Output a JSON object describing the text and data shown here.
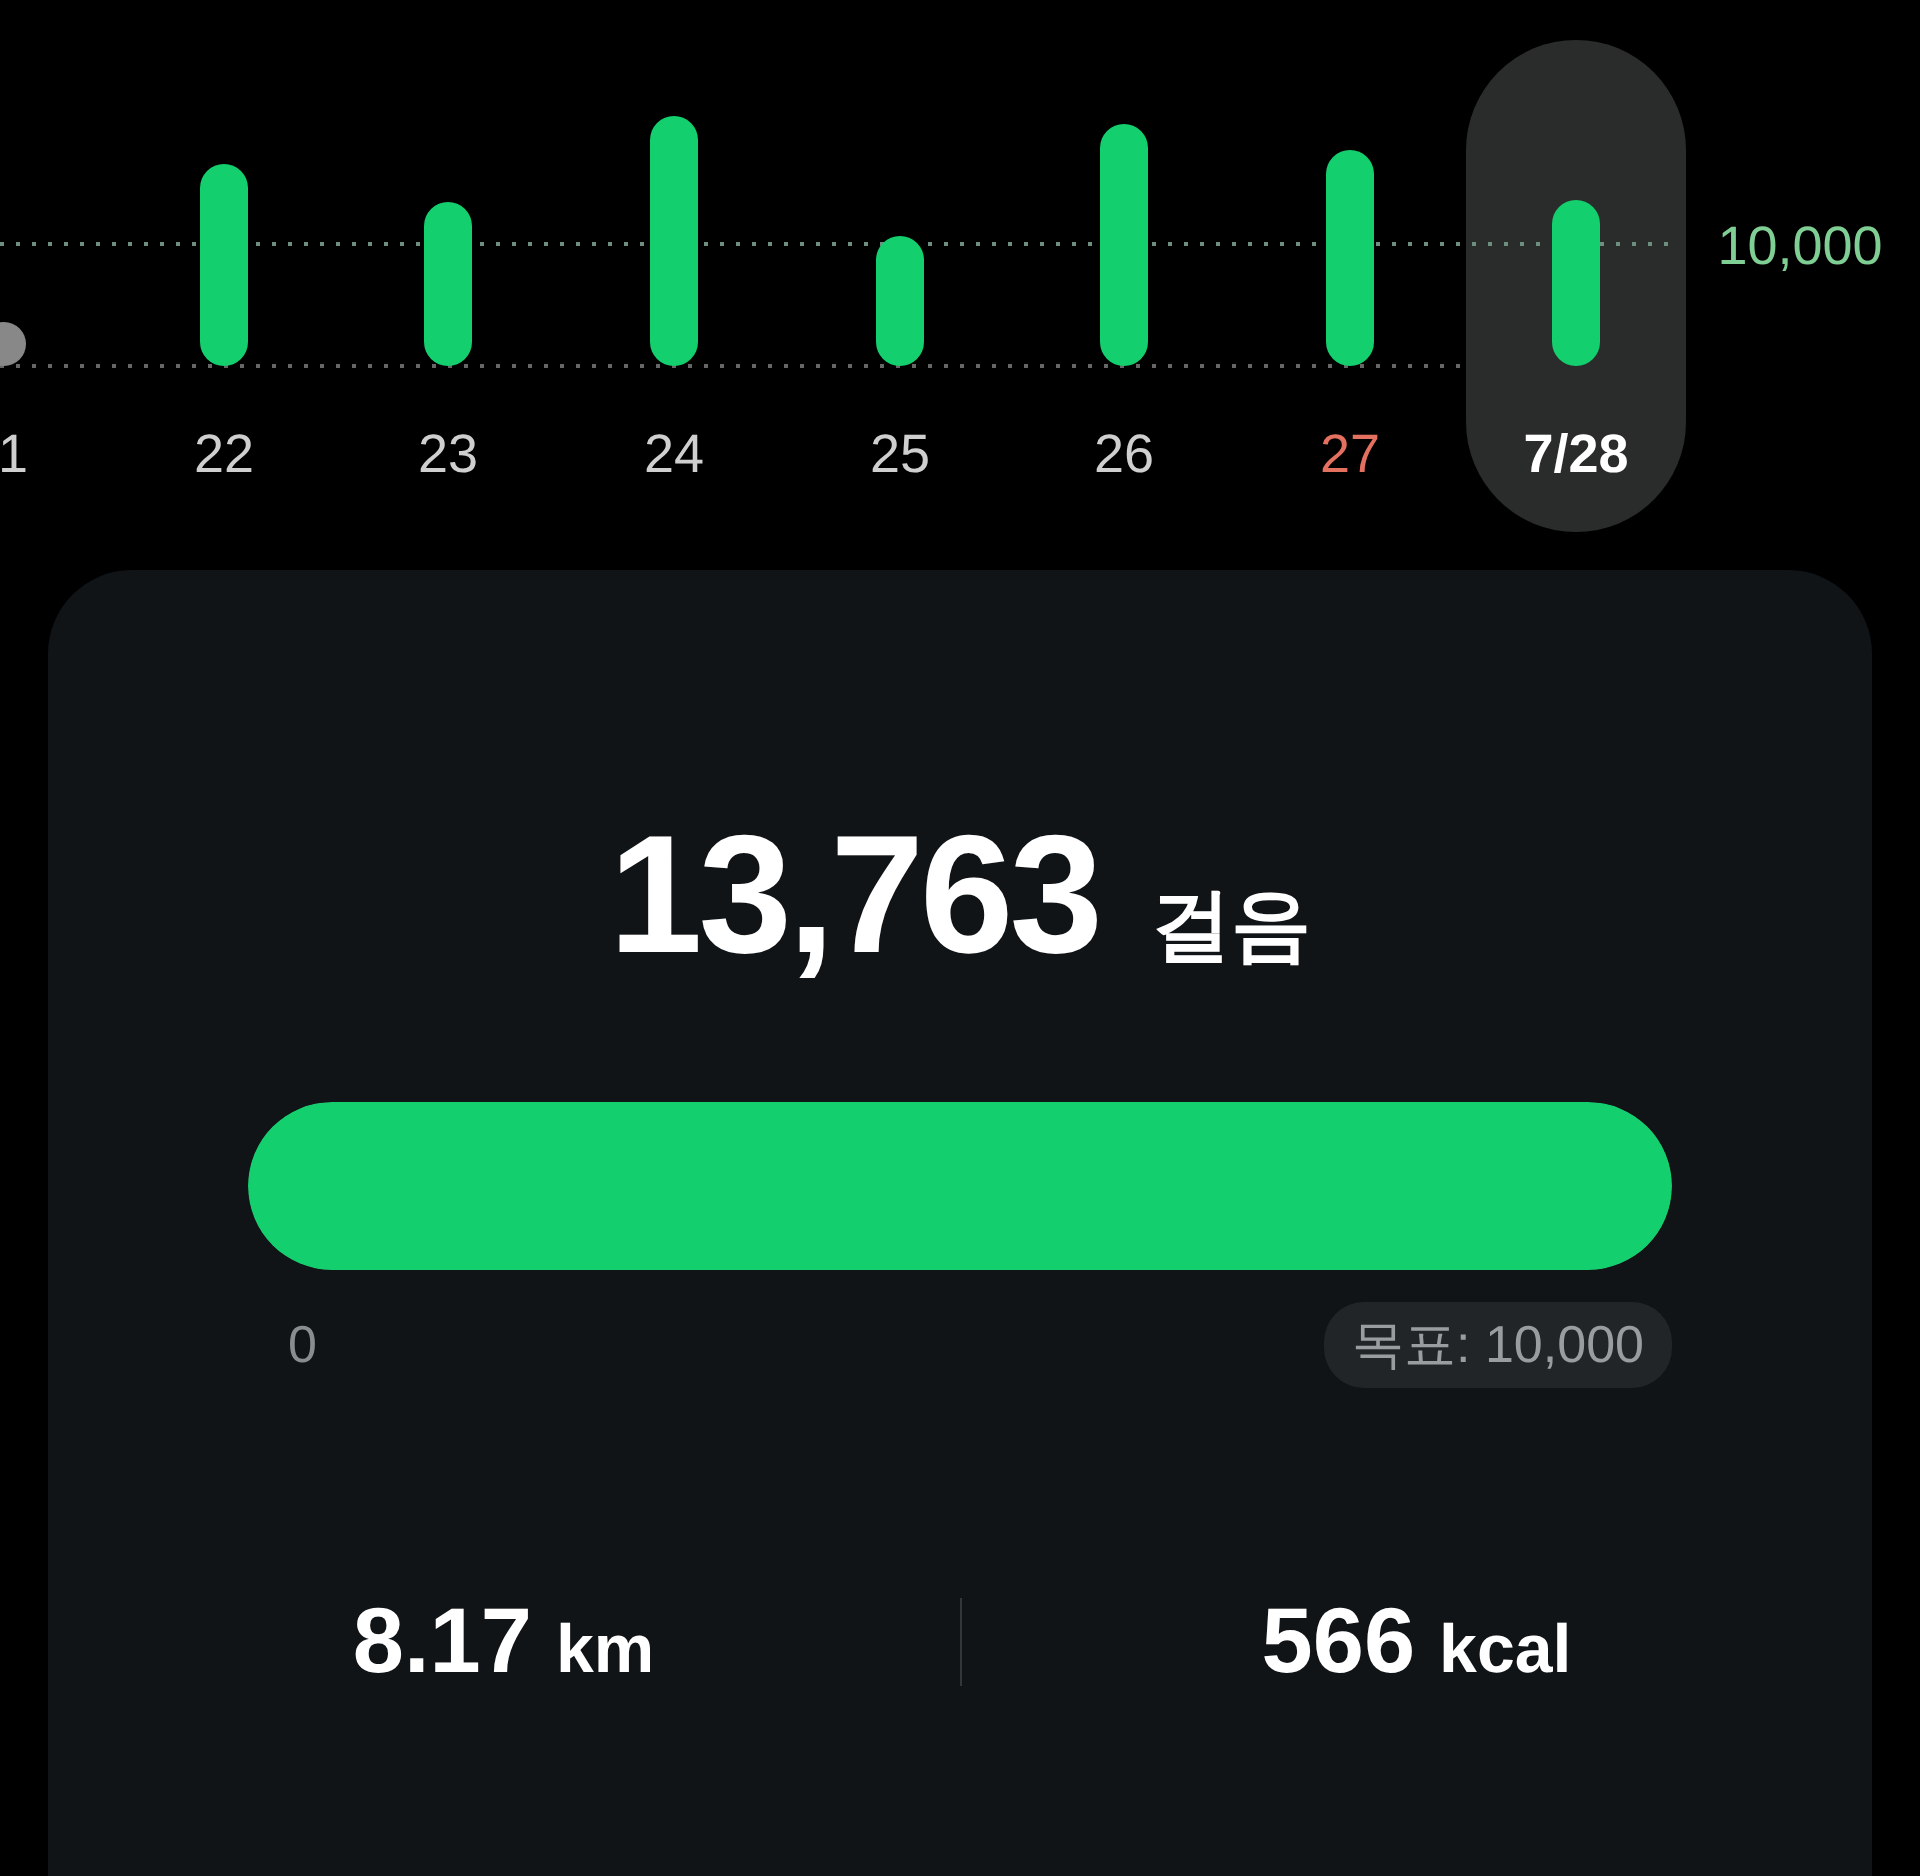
{
  "chart": {
    "goal_label": "10,000",
    "days": [
      {
        "label": "1",
        "selected": false,
        "color": "#cfcfcf"
      },
      {
        "label": "22",
        "selected": false,
        "color": "#cfcfcf"
      },
      {
        "label": "23",
        "selected": false,
        "color": "#cfcfcf"
      },
      {
        "label": "24",
        "selected": false,
        "color": "#cfcfcf"
      },
      {
        "label": "25",
        "selected": false,
        "color": "#cfcfcf"
      },
      {
        "label": "26",
        "selected": false,
        "color": "#cfcfcf"
      },
      {
        "label": "27",
        "selected": false,
        "color": "#e4705f"
      },
      {
        "label": "7/28",
        "selected": true,
        "color": "#ffffff"
      }
    ]
  },
  "summary": {
    "steps": "13,763",
    "steps_unit": "걸음",
    "level": 1,
    "min_label": "0",
    "goal": "목표: 10,000",
    "stats": [
      {
        "value": "8.17",
        "unit": "km"
      },
      {
        "value": "566",
        "unit": "kcal"
      }
    ]
  }
}
